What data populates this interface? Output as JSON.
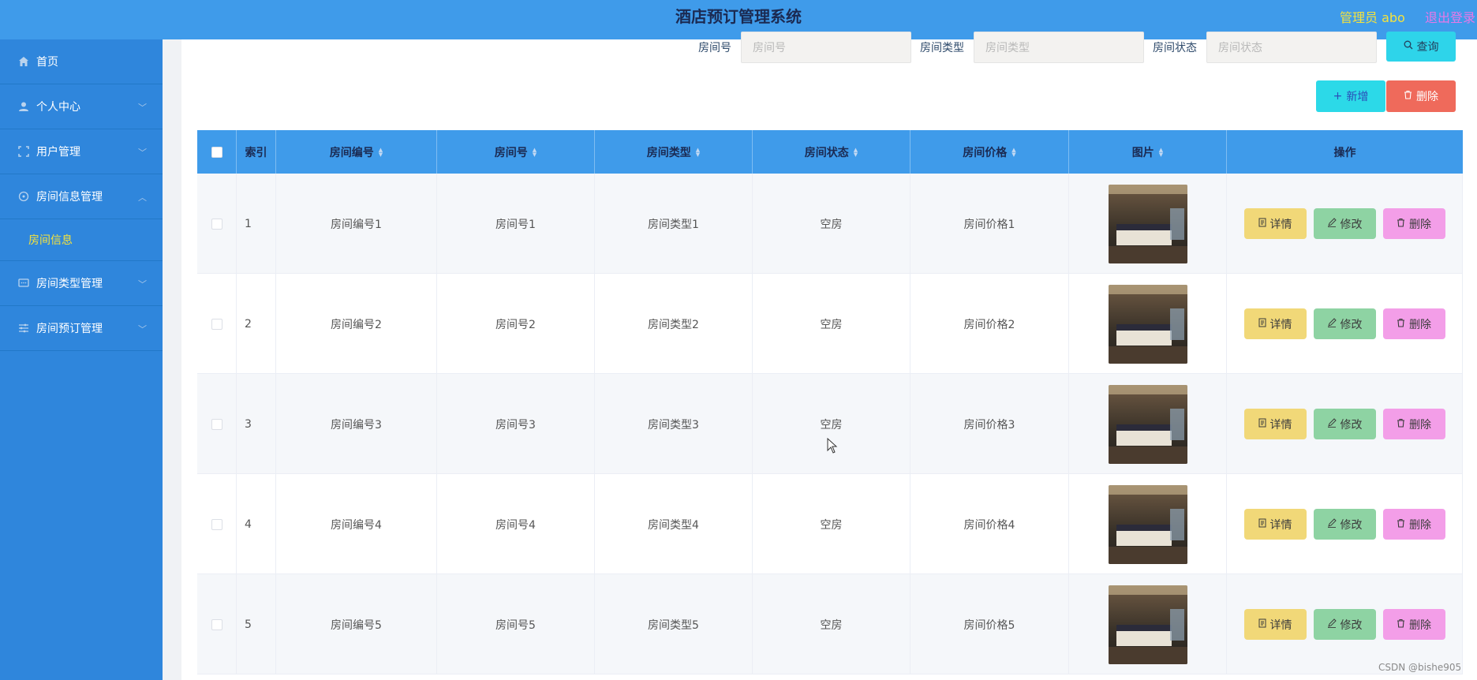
{
  "header": {
    "title": "酒店预订管理系统",
    "admin_label": "管理员 abo",
    "logout": "退出登录"
  },
  "sidebar": {
    "items": [
      {
        "label": "首页",
        "icon": "home-icon"
      },
      {
        "label": "个人中心",
        "icon": "user-icon"
      },
      {
        "label": "用户管理",
        "icon": "frame-icon"
      },
      {
        "label": "房间信息管理",
        "icon": "compass-icon"
      },
      {
        "label": "房间类型管理",
        "icon": "chat-icon"
      },
      {
        "label": "房间预订管理",
        "icon": "sliders-icon"
      }
    ],
    "sub_item": "房间信息"
  },
  "search": {
    "room_no_label": "房间号",
    "room_no_placeholder": "房间号",
    "room_type_label": "房间类型",
    "room_type_placeholder": "房间类型",
    "room_status_label": "房间状态",
    "room_status_placeholder": "房间状态",
    "query_button": "查询"
  },
  "toolbar": {
    "add_button": "新增",
    "delete_button": "删除"
  },
  "table": {
    "columns": [
      "索引",
      "房间编号",
      "房间号",
      "房间类型",
      "房间状态",
      "房间价格",
      "图片",
      "操作"
    ],
    "rows": [
      {
        "index": "1",
        "room_code": "房间编号1",
        "room_no": "房间号1",
        "room_type": "房间类型1",
        "status": "空房",
        "price": "房间价格1"
      },
      {
        "index": "2",
        "room_code": "房间编号2",
        "room_no": "房间号2",
        "room_type": "房间类型2",
        "status": "空房",
        "price": "房间价格2"
      },
      {
        "index": "3",
        "room_code": "房间编号3",
        "room_no": "房间号3",
        "room_type": "房间类型3",
        "status": "空房",
        "price": "房间价格3"
      },
      {
        "index": "4",
        "room_code": "房间编号4",
        "room_no": "房间号4",
        "room_type": "房间类型4",
        "status": "空房",
        "price": "房间价格4"
      },
      {
        "index": "5",
        "room_code": "房间编号5",
        "room_no": "房间号5",
        "room_type": "房间类型5",
        "status": "空房",
        "price": "房间价格5"
      }
    ],
    "actions": {
      "detail": "详情",
      "edit": "修改",
      "delete": "删除"
    }
  },
  "watermark": "CSDN @bishe905",
  "colors": {
    "header_bg": "#3f9bea",
    "sidebar_bg": "#2f86dc",
    "active_text": "#f4e23e",
    "detail_btn": "#f1d878",
    "edit_btn": "#8ed3a3",
    "delete_btn": "#f39ee8"
  }
}
